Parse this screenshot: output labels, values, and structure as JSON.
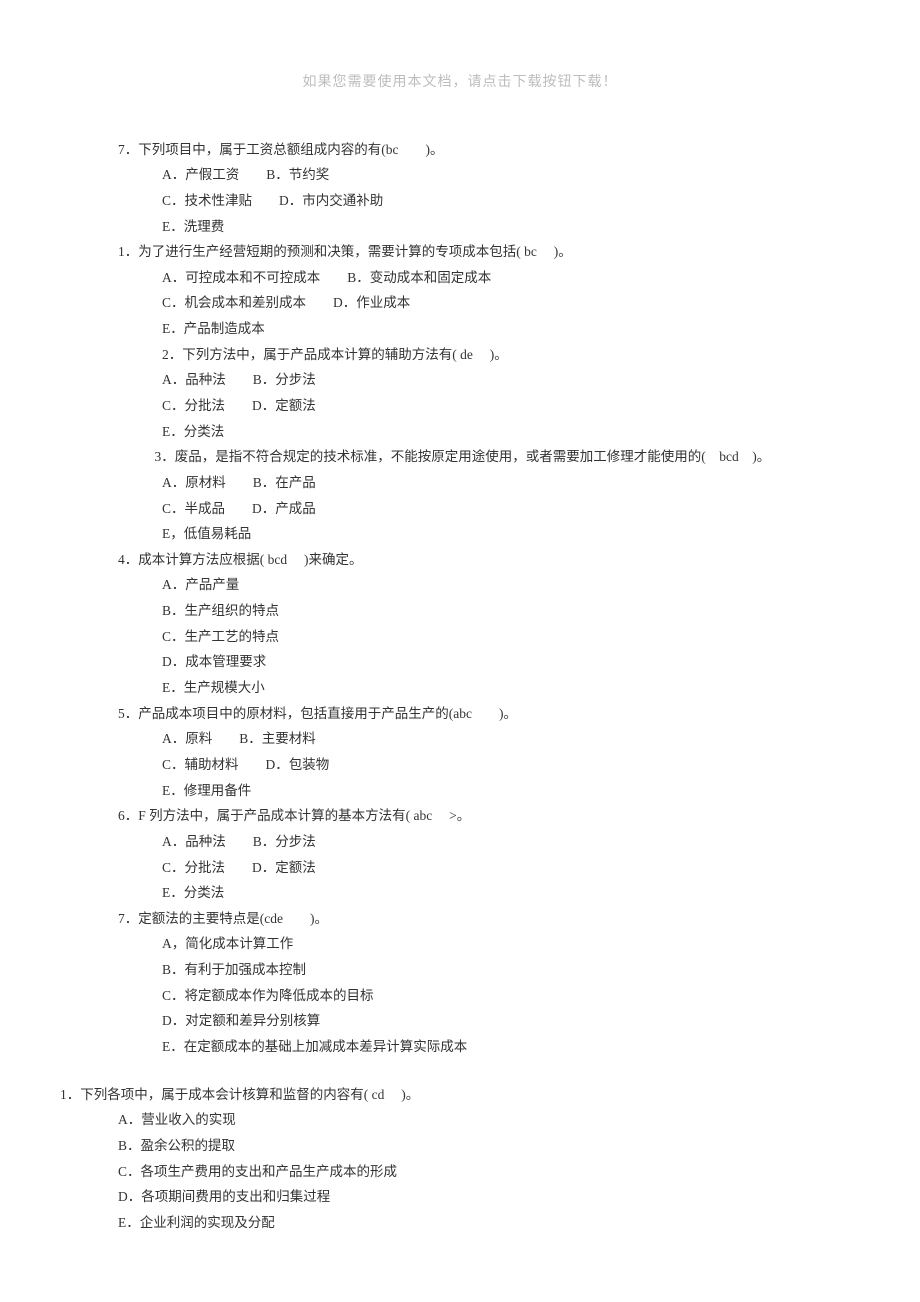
{
  "header_note": "如果您需要使用本文档，请点击下载按钮下载！",
  "sections": [
    {
      "lines": [
        {
          "cls": "indent-1",
          "text": "7．下列项目中，属于工资总额组成内容的有(bc　　)。"
        },
        {
          "cls": "indent-2",
          "text": "A．产假工资　　B．节约奖"
        },
        {
          "cls": "indent-2",
          "text": "C．技术性津贴　　D．市内交通补助"
        },
        {
          "cls": "indent-2",
          "text": "E．洗理费"
        },
        {
          "cls": "indent-1",
          "text": "1．为了进行生产经营短期的预测和决策，需要计算的专项成本包括( bc　 )。"
        },
        {
          "cls": "indent-2",
          "text": "A．可控成本和不可控成本　　B．变动成本和固定成本"
        },
        {
          "cls": "indent-2",
          "text": "C．机会成本和差别成本　　D．作业成本"
        },
        {
          "cls": "indent-2",
          "text": "E．产品制造成本"
        },
        {
          "cls": "indent-2",
          "text": "2．下列方法中，属于产品成本计算的辅助方法有( de　 )。"
        },
        {
          "cls": "indent-2",
          "text": "A．品种法　　B．分步法"
        },
        {
          "cls": "indent-2",
          "text": "C．分批法　　D．定额法"
        },
        {
          "cls": "indent-2",
          "text": "E．分类法"
        },
        {
          "cls": "wrap-line",
          "text": "　　　　　　　3．废品，是指不符合规定的技术标准，不能按原定用途使用，或者需要加工修理才能使用的(　bcd　)。"
        },
        {
          "cls": "indent-2",
          "text": "A．原材料　　B．在产品"
        },
        {
          "cls": "indent-2",
          "text": "C．半成品　　D．产成品"
        },
        {
          "cls": "indent-2",
          "text": "E，低值易耗品"
        },
        {
          "cls": "indent-1",
          "text": "4．成本计算方法应根据( bcd　 )来确定。"
        },
        {
          "cls": "indent-2",
          "text": "A．产品产量"
        },
        {
          "cls": "indent-2",
          "text": "B．生产组织的特点"
        },
        {
          "cls": "indent-2",
          "text": "C．生产工艺的特点"
        },
        {
          "cls": "indent-2",
          "text": "D．成本管理要求"
        },
        {
          "cls": "indent-2",
          "text": "E．生产规模大小"
        },
        {
          "cls": "indent-1",
          "text": "5．产品成本项目中的原材料，包括直接用于产品生产的(abc　　)。"
        },
        {
          "cls": "indent-2",
          "text": "A．原料　　B．主要材料"
        },
        {
          "cls": "indent-2",
          "text": "C．辅助材料　　D．包装物"
        },
        {
          "cls": "indent-2",
          "text": "E．修理用备件"
        },
        {
          "cls": "indent-1",
          "text": "6．F 列方法中，属于产品成本计算的基本方法有( abc　 >。"
        },
        {
          "cls": "indent-2",
          "text": "A．品种法　　B．分步法"
        },
        {
          "cls": "indent-2",
          "text": "C．分批法　　D．定额法"
        },
        {
          "cls": "indent-2",
          "text": "E．分类法"
        },
        {
          "cls": "indent-1",
          "text": "7．定额法的主要特点是(cde　　)。"
        },
        {
          "cls": "indent-2",
          "text": "A，简化成本计算工作"
        },
        {
          "cls": "indent-2",
          "text": "B．有利于加强成本控制"
        },
        {
          "cls": "indent-2",
          "text": "C．将定额成本作为降低成本的目标"
        },
        {
          "cls": "indent-2",
          "text": "D．对定额和差异分别核算"
        },
        {
          "cls": "indent-2",
          "text": "E．在定额成本的基础上加减成本差异计算实际成本"
        }
      ]
    },
    {
      "lines": [
        {
          "cls": "indent-0",
          "text": "1．下列各项中，属于成本会计核算和监督的内容有( cd　 )。"
        },
        {
          "cls": "indent-1",
          "text": "A．营业收入的实现"
        },
        {
          "cls": "indent-1",
          "text": "B．盈余公积的提取"
        },
        {
          "cls": "indent-1",
          "text": "C．各项生产费用的支出和产品生产成本的形成"
        },
        {
          "cls": "indent-1",
          "text": "D．各项期间费用的支出和归集过程"
        },
        {
          "cls": "indent-1",
          "text": "E．企业利润的实现及分配"
        }
      ]
    }
  ]
}
